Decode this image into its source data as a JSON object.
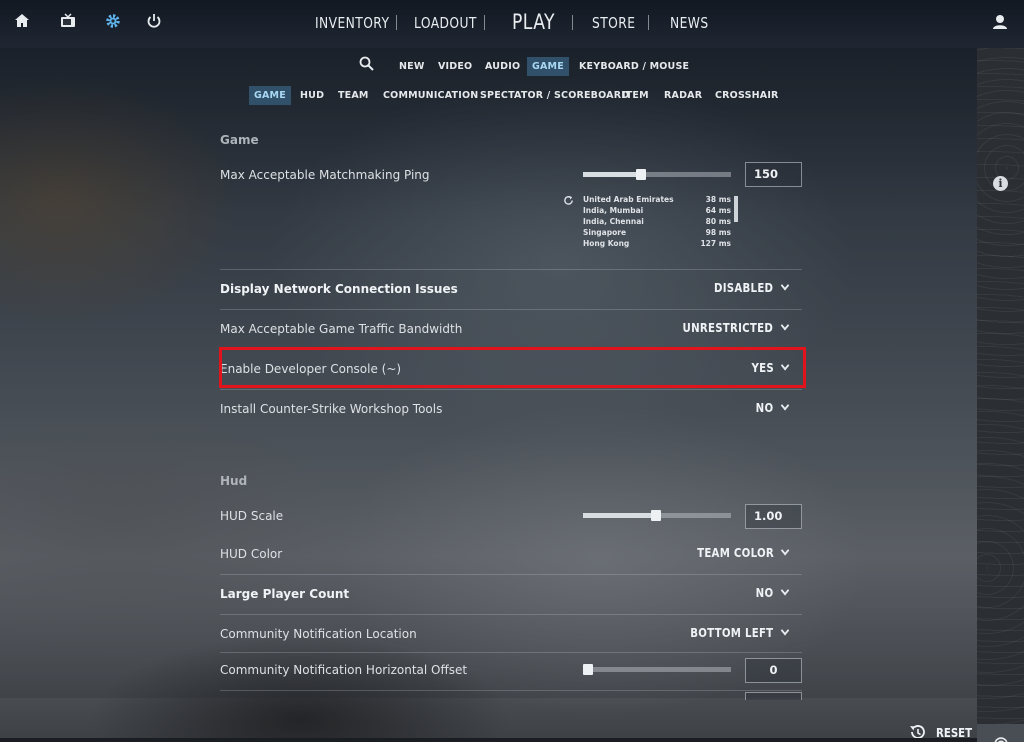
{
  "top_nav": {
    "items": [
      "INVENTORY",
      "LOADOUT",
      "PLAY",
      "STORE",
      "NEWS"
    ]
  },
  "subnav": {
    "tabs": [
      "NEW",
      "VIDEO",
      "AUDIO",
      "GAME",
      "KEYBOARD / MOUSE"
    ],
    "selected": "GAME"
  },
  "game_subnav": {
    "tabs": [
      "GAME",
      "HUD",
      "TEAM",
      "COMMUNICATION",
      "SPECTATOR / SCOREBOARD",
      "ITEM",
      "RADAR",
      "CROSSHAIR"
    ],
    "selected": "GAME"
  },
  "sections": {
    "game": "Game",
    "hud": "Hud"
  },
  "settings": {
    "matchmaking_ping": {
      "label": "Max Acceptable Matchmaking Ping",
      "value": "150",
      "slider_fraction": 0.4
    },
    "ping_list": [
      {
        "region": "United Arab Emirates",
        "ms": "38 ms"
      },
      {
        "region": "India, Mumbai",
        "ms": "64 ms"
      },
      {
        "region": "India, Chennai",
        "ms": "80 ms"
      },
      {
        "region": "Singapore",
        "ms": "98 ms"
      },
      {
        "region": "Hong Kong",
        "ms": "127 ms"
      }
    ],
    "network_issues": {
      "label": "Display Network Connection Issues",
      "value": "DISABLED"
    },
    "traffic_bandwidth": {
      "label": "Max Acceptable Game Traffic Bandwidth",
      "value": "UNRESTRICTED"
    },
    "dev_console": {
      "label": "Enable Developer Console (~)",
      "value": "YES"
    },
    "workshop_tools": {
      "label": "Install Counter-Strike Workshop Tools",
      "value": "NO"
    },
    "hud_scale": {
      "label": "HUD Scale",
      "value": "1.00",
      "slider_fraction": 0.5
    },
    "hud_color": {
      "label": "HUD Color",
      "value": "TEAM COLOR"
    },
    "large_player_count": {
      "label": "Large Player Count",
      "value": "NO"
    },
    "community_location": {
      "label": "Community Notification Location",
      "value": "BOTTOM LEFT"
    },
    "community_h_offset": {
      "label": "Community Notification Horizontal Offset",
      "value": "0",
      "slider_fraction": 0.0
    }
  },
  "footer": {
    "reset_label": "RESET"
  },
  "colors": {
    "accent_selected_bg": "#31506a",
    "accent_selected_text": "#a9d8f4",
    "highlight_border": "#e3131c",
    "settings_icon": "#5fb4ee"
  },
  "icons": [
    "home-icon",
    "tv-icon",
    "gear-icon",
    "power-icon",
    "user-icon",
    "search-icon",
    "refresh-icon",
    "info-icon",
    "broadcast-icon",
    "reset-history-icon",
    "chevron-down-icon"
  ]
}
